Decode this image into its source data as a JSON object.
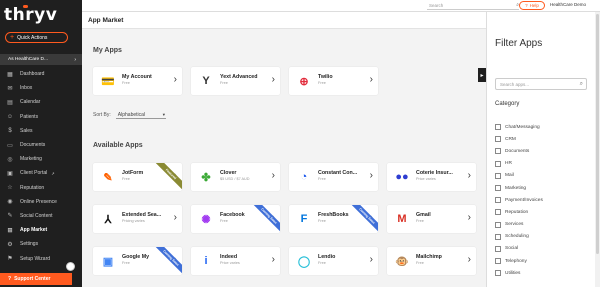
{
  "sidebar": {
    "logo": "thryv",
    "quick_actions": "Quick Actions",
    "account": "As HealthCare D...",
    "items": [
      {
        "label": "Dashboard",
        "icon": "dashboard-icon",
        "glyph": "▦"
      },
      {
        "label": "Inbox",
        "icon": "inbox-icon",
        "glyph": "✉"
      },
      {
        "label": "Calendar",
        "icon": "calendar-icon",
        "glyph": "▤"
      },
      {
        "label": "Patients",
        "icon": "patients-icon",
        "glyph": "☺"
      },
      {
        "label": "Sales",
        "icon": "sales-icon",
        "glyph": "$"
      },
      {
        "label": "Documents",
        "icon": "documents-icon",
        "glyph": "▭"
      },
      {
        "label": "Marketing",
        "icon": "marketing-icon",
        "glyph": "◎"
      },
      {
        "label": "Client Portal",
        "icon": "client-portal-icon",
        "glyph": "▣",
        "external": true
      },
      {
        "label": "Reputation",
        "icon": "reputation-icon",
        "glyph": "☆"
      },
      {
        "label": "Online Presence",
        "icon": "online-presence-icon",
        "glyph": "◉"
      },
      {
        "label": "Social Content",
        "icon": "social-content-icon",
        "glyph": "✎"
      },
      {
        "label": "App Market",
        "icon": "app-market-icon",
        "glyph": "⊞",
        "active": true
      },
      {
        "label": "Settings",
        "icon": "settings-icon",
        "glyph": "⚙"
      },
      {
        "label": "Setup Wizard",
        "icon": "setup-wizard-icon",
        "glyph": "⚑"
      }
    ],
    "support": "Support Center"
  },
  "topbar": {
    "search_placeholder": "Search",
    "help": "Help",
    "user": "HealthCare Demo"
  },
  "header": {
    "title": "App Market"
  },
  "my_apps": {
    "title": "My Apps",
    "apps": [
      {
        "name": "My Account",
        "sub": "Free",
        "icon": "my-account-icon",
        "glyph": "💳",
        "color": "#333333"
      },
      {
        "name": "Yext Advanced",
        "sub": "Free",
        "icon": "yext-icon",
        "glyph": "Y",
        "color": "#333333"
      },
      {
        "name": "Twilio",
        "sub": "Free",
        "icon": "twilio-icon",
        "glyph": "⊕",
        "color": "#e22c3c"
      }
    ]
  },
  "sort": {
    "label": "Sort By:",
    "value": "Alphabetical"
  },
  "available_apps": {
    "title": "Available Apps",
    "apps": [
      {
        "name": "JotForm",
        "sub": "Free",
        "icon": "jotform-icon",
        "glyph": "✎",
        "color": "#ff6100",
        "ribbon": "Featured",
        "ribbon_color": "#8a8a33"
      },
      {
        "name": "Clover",
        "sub": "$5 USD / $7 AUD",
        "icon": "clover-icon",
        "glyph": "✤",
        "color": "#3aa935"
      },
      {
        "name": "Constant Con...",
        "sub": "Free",
        "icon": "constant-contact-icon",
        "glyph": "◔",
        "color": "#1856ed"
      },
      {
        "name": "Coterie Insur...",
        "sub": "Price varies",
        "icon": "coterie-icon",
        "glyph": "●●",
        "color": "#2e3dd1"
      },
      {
        "name": "Extended Sea...",
        "sub": "Pricing varies",
        "icon": "extended-search-icon",
        "glyph": "⅄",
        "color": "#111111"
      },
      {
        "name": "Facebook",
        "sub": "Free",
        "icon": "facebook-messenger-icon",
        "glyph": "✺",
        "color": "#a23cf1",
        "ribbon": "Coming Soon",
        "ribbon_color": "#3f6fd8"
      },
      {
        "name": "FreshBooks",
        "sub": "Free",
        "icon": "freshbooks-icon",
        "glyph": "F",
        "color": "#0075dd",
        "ribbon": "Coming Soon",
        "ribbon_color": "#3f6fd8"
      },
      {
        "name": "Gmail",
        "sub": "Free",
        "icon": "gmail-icon",
        "glyph": "M",
        "color": "#d93025"
      },
      {
        "name": "Google My",
        "sub": "Free",
        "icon": "google-my-business-icon",
        "glyph": "▣",
        "color": "#4285f4",
        "ribbon": "Coming Soon",
        "ribbon_color": "#3f6fd8"
      },
      {
        "name": "Indeed",
        "sub": "Price varies",
        "icon": "indeed-icon",
        "glyph": "i",
        "color": "#2164f3"
      },
      {
        "name": "Lendio",
        "sub": "Free",
        "icon": "lendio-icon",
        "glyph": "◯",
        "color": "#29c0d8"
      },
      {
        "name": "Mailchimp",
        "sub": "Free",
        "icon": "mailchimp-icon",
        "glyph": "🐵",
        "color": "#222222"
      }
    ]
  },
  "filter": {
    "title": "Filter Apps",
    "search_placeholder": "Search apps...",
    "category_title": "Category",
    "categories": [
      "Chat/Messaging",
      "CRM",
      "Documents",
      "HR",
      "Mail",
      "Marketing",
      "Payment/Invoices",
      "Reputation",
      "Services",
      "Scheduling",
      "Social",
      "Telephony",
      "Utilities"
    ]
  },
  "colors": {
    "accent": "#ff5a1f",
    "sidebar": "#1f1f1f"
  }
}
